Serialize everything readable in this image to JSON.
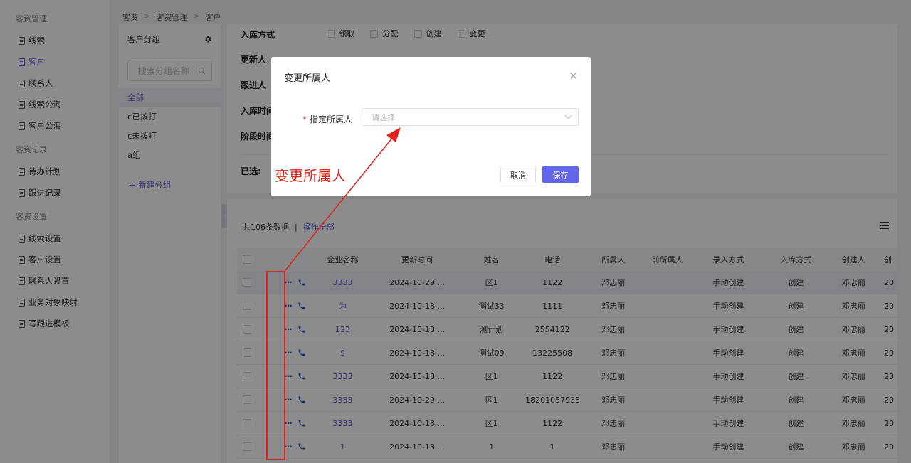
{
  "sidebar": {
    "groups": [
      {
        "title": "客资管理",
        "items": [
          "线索",
          "客户",
          "联系人",
          "线索公海",
          "客户公海"
        ]
      },
      {
        "title": "客资记录",
        "items": [
          "待办计划",
          "跟进记录"
        ]
      },
      {
        "title": "客资设置",
        "items": [
          "线索设置",
          "客户设置",
          "联系人设置",
          "业务对象映射",
          "写跟进模板"
        ]
      }
    ],
    "active_item": "客户"
  },
  "breadcrumb": [
    "客资",
    "客资管理",
    "客户"
  ],
  "group_panel": {
    "title": "客户分组",
    "search_placeholder": "搜索分组名称",
    "items": [
      "全部",
      "c已拨打",
      "c未拨打",
      "a组"
    ],
    "new_group": "+ 新建分组"
  },
  "filter": {
    "rows": [
      "入库方式",
      "更新人",
      "跟进人",
      "入库时间",
      "阶段时间"
    ],
    "stock_options": [
      "领取",
      "分配",
      "创建",
      "变更"
    ],
    "selected_label": "已选:"
  },
  "table": {
    "summary": "共106条数据",
    "summary_sep": "|",
    "operate_all": "操作全部",
    "headers": [
      "企业名称",
      "更新时间",
      "姓名",
      "电话",
      "所属人",
      "前所属人",
      "录入方式",
      "入库方式",
      "创建人",
      "创"
    ],
    "rows": [
      {
        "company": "3333",
        "time": "2024-10-29 ...",
        "name": "区1",
        "tel": "1122",
        "owner": "邓忠丽",
        "prev": "",
        "entry": "手动创建",
        "stock": "创建",
        "creator": "邓忠丽",
        "cut": "20"
      },
      {
        "company": "为",
        "time": "2024-10-18 ...",
        "name": "测试33",
        "tel": "1111",
        "owner": "邓忠丽",
        "prev": "",
        "entry": "手动创建",
        "stock": "创建",
        "creator": "邓忠丽",
        "cut": "20"
      },
      {
        "company": "123",
        "time": "2024-10-18 ...",
        "name": "测计划",
        "tel": "2554122",
        "owner": "邓忠丽",
        "prev": "",
        "entry": "手动创建",
        "stock": "创建",
        "creator": "邓忠丽",
        "cut": "20"
      },
      {
        "company": "9",
        "time": "2024-10-18 ...",
        "name": "测试09",
        "tel": "13225508",
        "owner": "邓忠丽",
        "prev": "",
        "entry": "手动创建",
        "stock": "创建",
        "creator": "邓忠丽",
        "cut": "20"
      },
      {
        "company": "3333",
        "time": "2024-10-18 ...",
        "name": "区1",
        "tel": "1122",
        "owner": "邓忠丽",
        "prev": "",
        "entry": "手动创建",
        "stock": "创建",
        "creator": "邓忠丽",
        "cut": "20"
      },
      {
        "company": "3333",
        "time": "2024-10-29 ...",
        "name": "区1",
        "tel": "18201057933",
        "owner": "邓忠丽",
        "prev": "",
        "entry": "手动创建",
        "stock": "创建",
        "creator": "邓忠丽",
        "cut": "20"
      },
      {
        "company": "3333",
        "time": "2024-10-18 ...",
        "name": "区1",
        "tel": "1122",
        "owner": "邓忠丽",
        "prev": "",
        "entry": "手动创建",
        "stock": "创建",
        "creator": "邓忠丽",
        "cut": "20"
      },
      {
        "company": "1",
        "time": "2024-10-18 ...",
        "name": "1",
        "tel": "1",
        "owner": "邓忠丽",
        "prev": "",
        "entry": "手动创建",
        "stock": "创建",
        "creator": "邓忠丽",
        "cut": "20"
      }
    ],
    "row_action_dots": "···"
  },
  "modal": {
    "title": "变更所属人",
    "close": "×",
    "field_required_mark": "*",
    "field_label": "指定所属人",
    "select_placeholder": "请选择",
    "cancel": "取消",
    "save": "保存"
  },
  "annotation": {
    "text": "变更所属人",
    "color": "#e0211b"
  },
  "colors": {
    "accent": "#5b5bd6",
    "primary_button": "#6366e8"
  }
}
